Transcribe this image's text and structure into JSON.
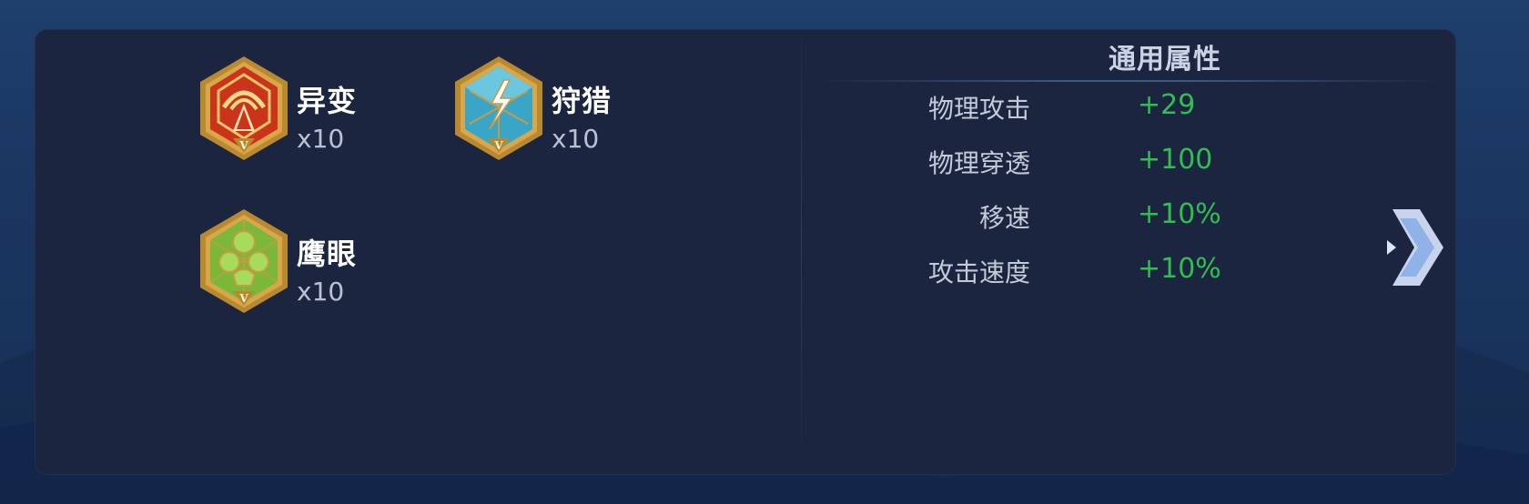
{
  "runes": [
    {
      "name": "异变",
      "count": "x10",
      "icon": "red-rune-icon",
      "tier": "V"
    },
    {
      "name": "狩猎",
      "count": "x10",
      "icon": "blue-rune-icon",
      "tier": "V"
    },
    {
      "name": "鹰眼",
      "count": "x10",
      "icon": "green-rune-icon",
      "tier": "V"
    }
  ],
  "attributes": {
    "title": "通用属性",
    "rows": [
      {
        "label": "物理攻击",
        "value": "+29"
      },
      {
        "label": "物理穿透",
        "value": "+100"
      },
      {
        "label": "移速",
        "value": "+10%"
      },
      {
        "label": "攻击速度",
        "value": "+10%"
      }
    ]
  },
  "colors": {
    "panel": "#1b2540",
    "value_green": "#2fbf4e",
    "red_rune": "#c9341a",
    "blue_rune": "#3aa6c7",
    "green_rune": "#7ab83a",
    "gold_frame": "#d9a64a"
  },
  "icons": {
    "next": "chevron-right-icon"
  }
}
